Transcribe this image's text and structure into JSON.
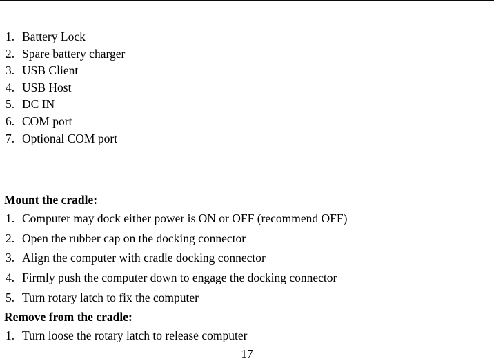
{
  "page": {
    "page_number": "17",
    "ink_color": "#000000",
    "paper_color": "#ffffff"
  },
  "ports_list": {
    "items": [
      {
        "marker": "1.",
        "text": "Battery Lock"
      },
      {
        "marker": "2.",
        "text": "Spare battery charger"
      },
      {
        "marker": "3.",
        "text": "USB Client"
      },
      {
        "marker": "4.",
        "text": "USB Host"
      },
      {
        "marker": "5.",
        "text": "DC IN"
      },
      {
        "marker": "6.",
        "text": "COM port"
      },
      {
        "marker": "7.",
        "text": "Optional COM port"
      }
    ]
  },
  "mount_section": {
    "heading": "Mount the cradle:",
    "items": [
      {
        "marker": "1.",
        "text": "Computer may dock either power is ON or OFF (recommend OFF)"
      },
      {
        "marker": "2.",
        "text": "Open the rubber cap on the docking connector"
      },
      {
        "marker": "3.",
        "text": "Align the computer with cradle docking connector"
      },
      {
        "marker": "4.",
        "text": "Firmly push the computer down to engage the docking connector"
      },
      {
        "marker": "5.",
        "text": "Turn rotary latch to fix the computer"
      }
    ]
  },
  "remove_section": {
    "heading": "Remove from the cradle:",
    "items": [
      {
        "marker": "1.",
        "text": "Turn loose the rotary latch to release computer"
      }
    ]
  }
}
